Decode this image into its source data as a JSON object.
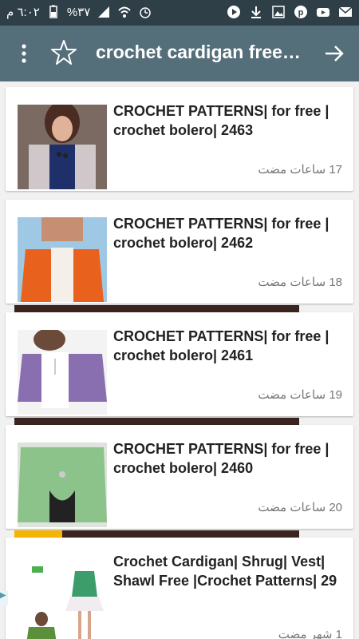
{
  "status": {
    "time": "٦:٠٢ م",
    "battery": "%٣٧"
  },
  "appbar": {
    "title": "crochet cardigan free…"
  },
  "items": [
    {
      "title": "CROCHET PATTERNS| for free | crochet bolero| 2463",
      "time": "17 ساعات مضت"
    },
    {
      "title": "CROCHET PATTERNS| for free | crochet bolero| 2462",
      "time": "18 ساعات مضت"
    },
    {
      "title": "CROCHET PATTERNS| for free | crochet bolero| 2461",
      "time": "19 ساعات مضت"
    },
    {
      "title": "CROCHET PATTERNS| for free | crochet bolero| 2460",
      "time": "20 ساعات مضت"
    },
    {
      "title": "Crochet Cardigan| Shrug| Vest| Shawl Free |Crochet Patterns| 29",
      "time": "1 شهر مضت"
    }
  ]
}
